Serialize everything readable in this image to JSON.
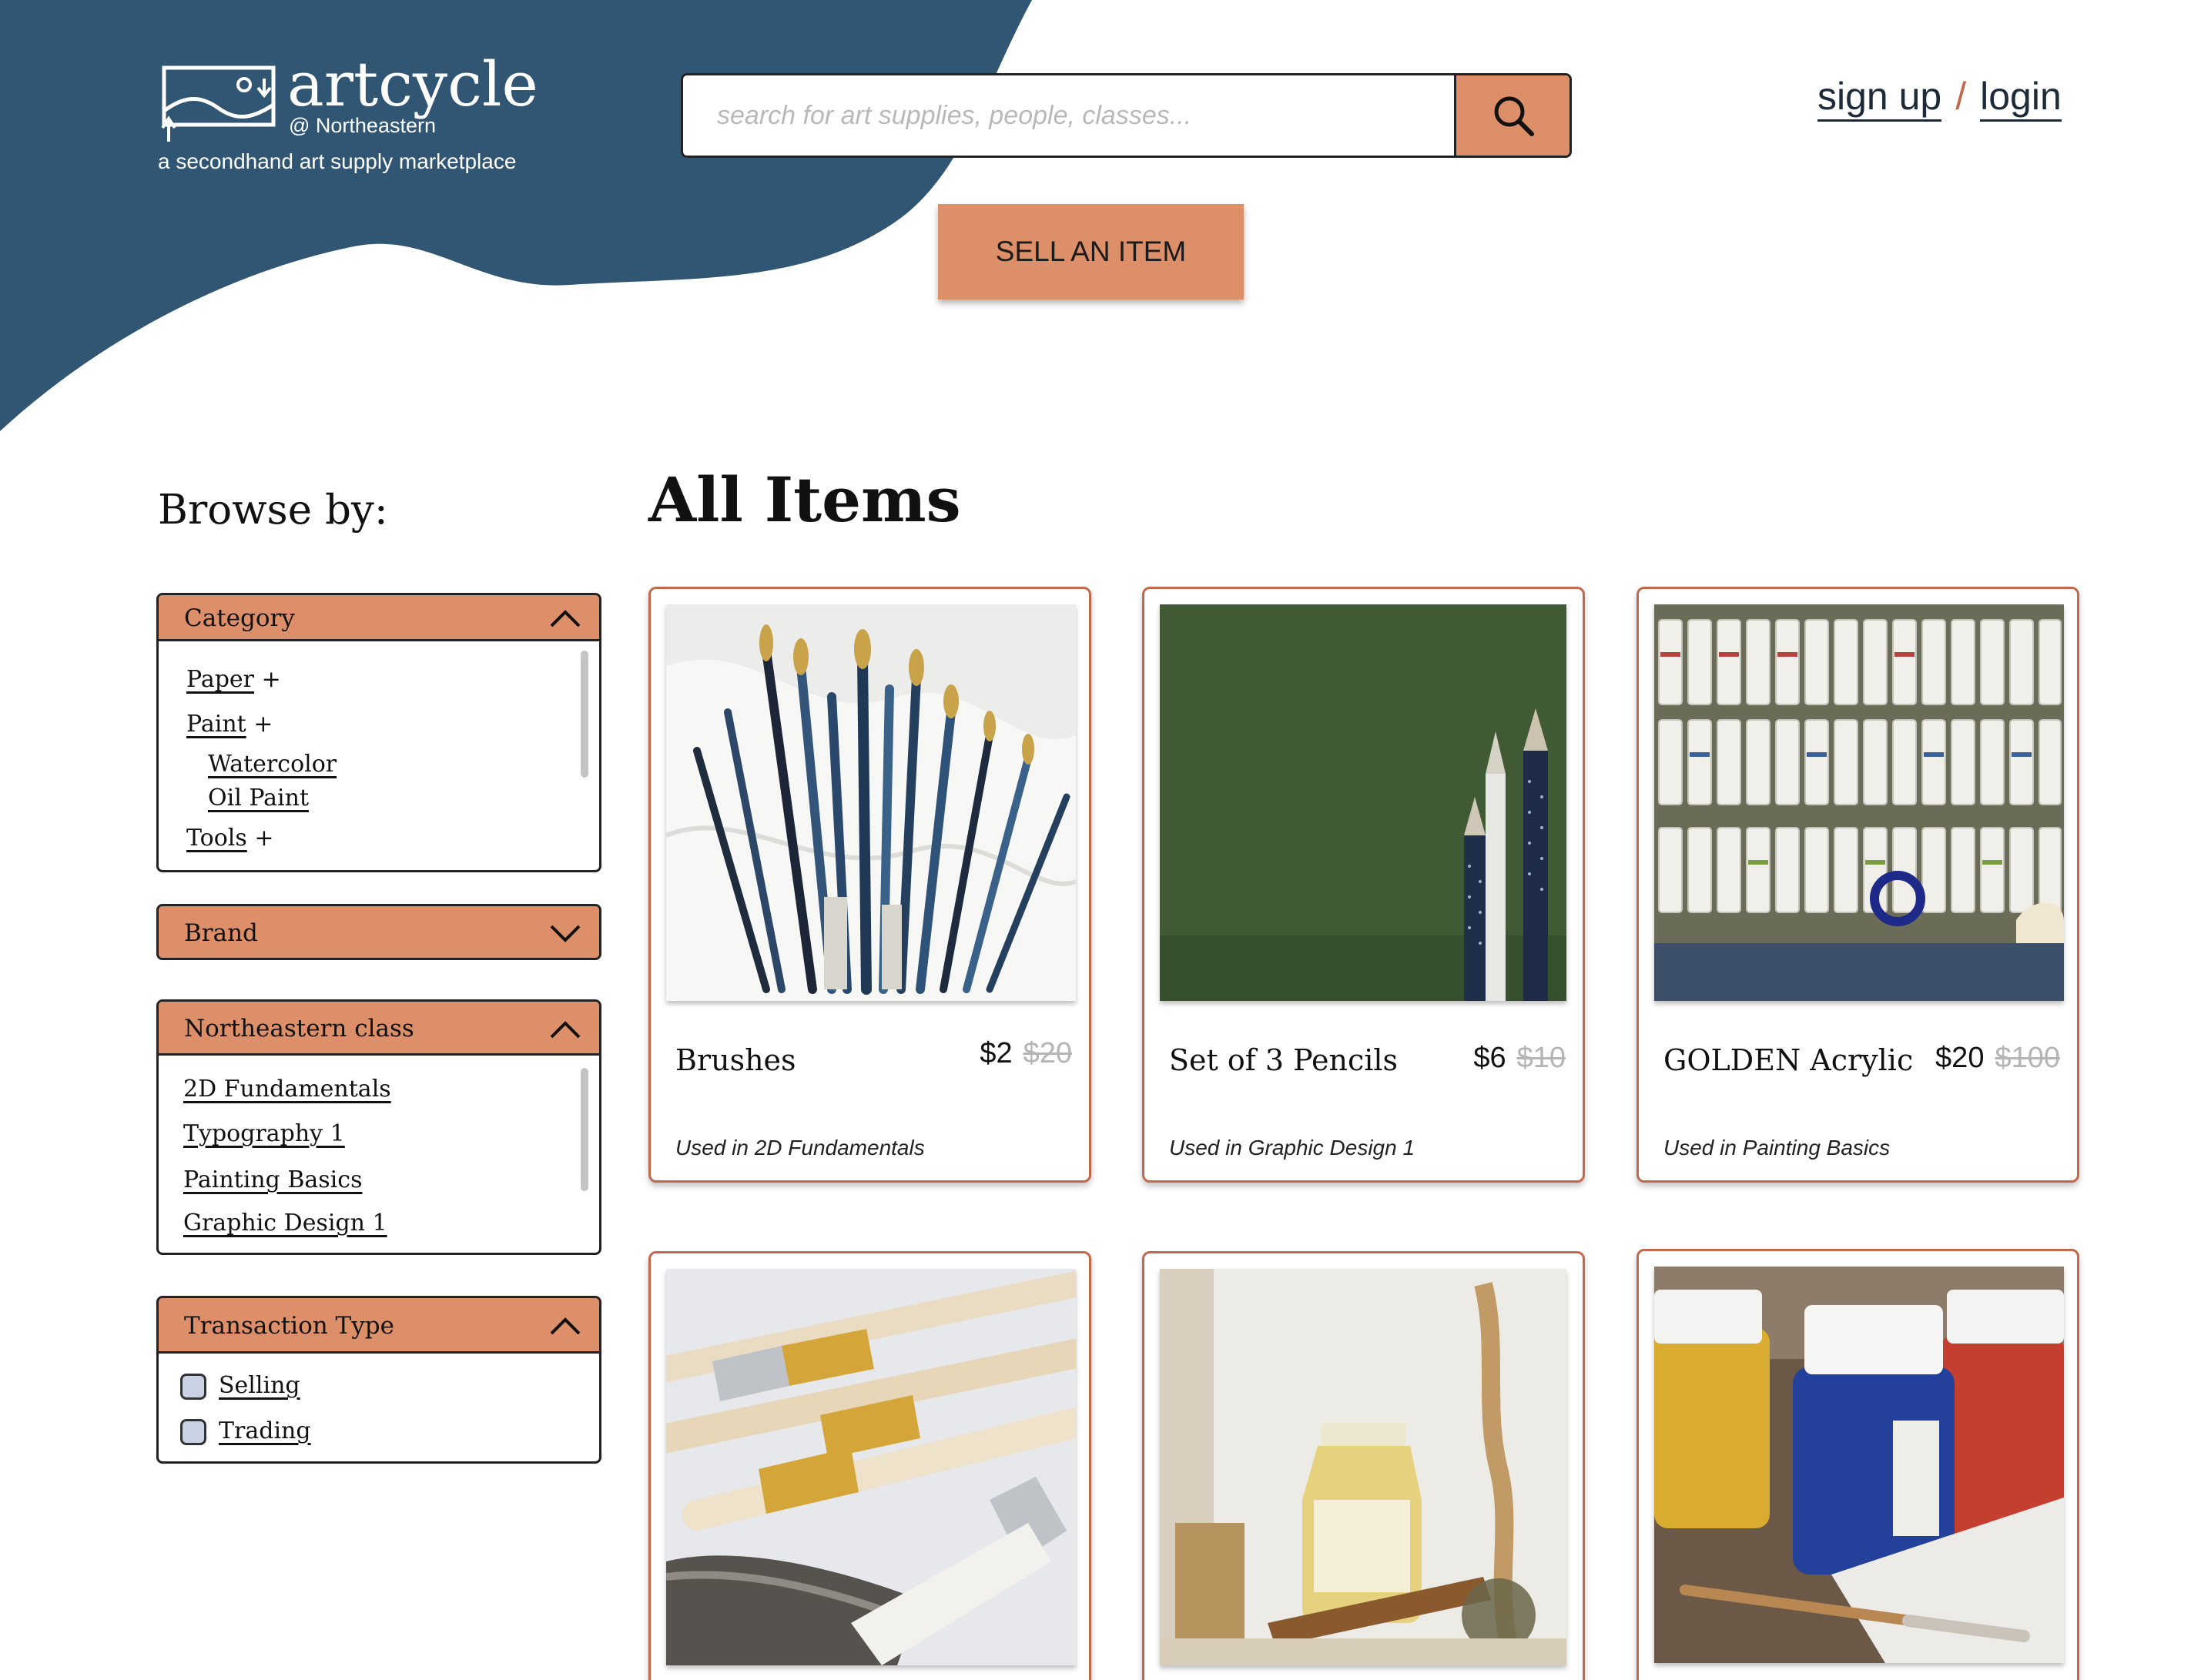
{
  "brand": {
    "name": "artcycle",
    "location": "@ Northeastern",
    "tagline": "a secondhand art supply marketplace"
  },
  "search": {
    "placeholder": "search for art supplies, people, classes..."
  },
  "auth": {
    "signup": "sign up",
    "separator": "/",
    "login": "login"
  },
  "sell_button": "SELL AN ITEM",
  "sidebar": {
    "title": "Browse by:",
    "category": {
      "title": "Category",
      "items": [
        {
          "label": "Paper",
          "suffix": "+"
        },
        {
          "label": "Paint",
          "suffix": "+"
        },
        {
          "label": "Watercolor"
        },
        {
          "label": "Oil Paint"
        },
        {
          "label": "Tools",
          "suffix": "+"
        }
      ]
    },
    "brand": {
      "title": "Brand"
    },
    "classes": {
      "title": "Northeastern class",
      "items": [
        "2D Fundamentals",
        "Typography 1",
        "Painting Basics",
        "Graphic Design 1"
      ]
    },
    "transaction": {
      "title": "Transaction Type",
      "options": [
        "Selling",
        "Trading"
      ]
    }
  },
  "main": {
    "title": "All Items",
    "cards": [
      {
        "title": "Brushes",
        "price": "$2",
        "old_price": "$20",
        "used": "Used in 2D Fundamentals"
      },
      {
        "title": "Set of 3 Pencils",
        "price": "$6",
        "old_price": "$10",
        "used": "Used in Graphic Design 1"
      },
      {
        "title": "GOLDEN Acrylic",
        "price": "$20",
        "old_price": "$100",
        "used": "Used in Painting Basics"
      }
    ]
  },
  "colors": {
    "navy": "#305673",
    "accent": "#dc8f68",
    "card_border": "#c5674a",
    "separator": "#c5674a"
  },
  "icons": [
    "search-icon",
    "chevron-up-icon",
    "chevron-down-icon",
    "logo-icon"
  ]
}
